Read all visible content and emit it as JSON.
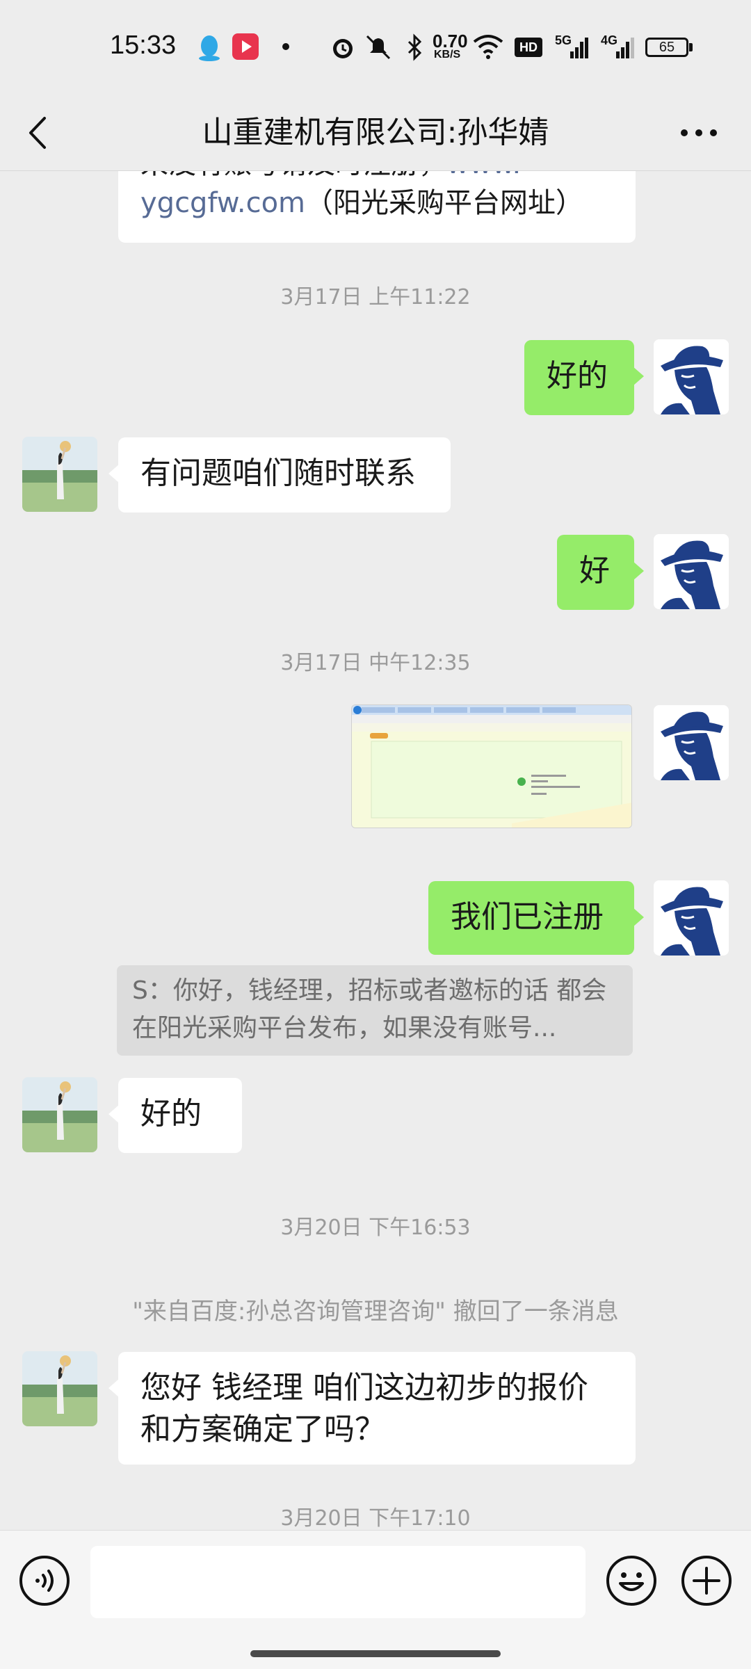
{
  "status_bar": {
    "time": "15:33",
    "net_speed_value": "0.70",
    "net_speed_unit": "KB/S",
    "hd_label": "HD",
    "signal1_label": "5G",
    "signal2_label": "4G",
    "battery": "65",
    "icons": [
      "qq-icon",
      "video-app-icon",
      "dot-icon",
      "alarm-icon",
      "mute-icon",
      "bluetooth-icon",
      "wifi-icon",
      "hd-icon",
      "signal-5g-icon",
      "signal-4g-icon",
      "battery-icon"
    ]
  },
  "header": {
    "title": "山重建机有限公司:孙华婧"
  },
  "messages": {
    "m0_line1": "来没有账号请及时注册，",
    "m0_link1": "www.",
    "m0_link2": "ygcgfw.com",
    "m0_line2": "（阳光采购平台网址）",
    "ts1": "3月17日 上午11:22",
    "m1": "好的",
    "m2": "有问题咱们随时联系",
    "m3": "好",
    "ts2": "3月17日 中午12:35",
    "m5": "我们已注册",
    "quote": "S：你好，钱经理，招标或者邀标的话 都会在阳光采购平台发布，如果没有账号...",
    "m6": "好的",
    "ts3": "3月20日 下午16:53",
    "recall": "\"来自百度:孙总咨询管理咨询\" 撤回了一条消息",
    "m7": "您好  钱经理 咱们这边初步的报价和方案确定了吗？",
    "ts4": "3月20日 下午17:10"
  },
  "colors": {
    "background": "#ededed",
    "sent_bubble": "#95ec69",
    "received_bubble": "#ffffff",
    "link": "#576b95",
    "timestamp": "#9a9a9a"
  },
  "input_bar": {
    "icons": [
      "voice-icon",
      "emoji-icon",
      "plus-icon"
    ]
  }
}
